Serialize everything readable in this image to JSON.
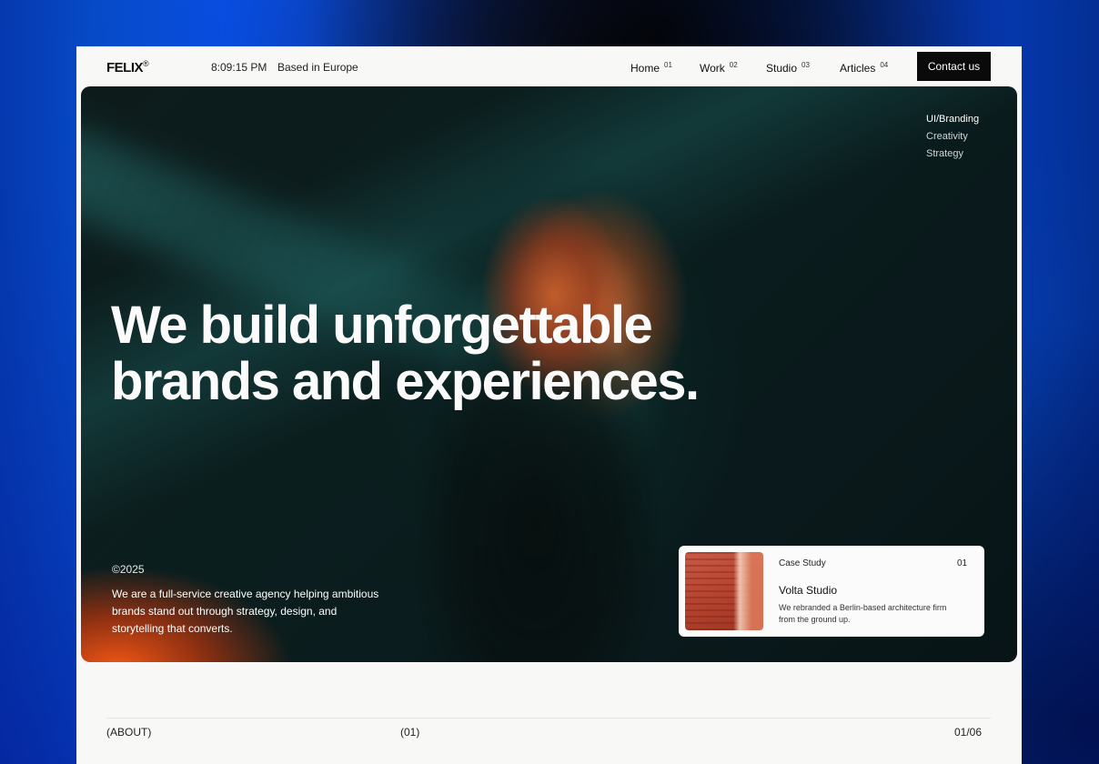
{
  "header": {
    "logo": "FELIX",
    "logo_mark": "®",
    "clock": "8:09:15 PM",
    "location": "Based in Europe",
    "nav": [
      {
        "label": "Home",
        "num": "01"
      },
      {
        "label": "Work",
        "num": "02"
      },
      {
        "label": "Studio",
        "num": "03"
      },
      {
        "label": "Articles",
        "num": "04"
      }
    ],
    "contact_label": "Contact us"
  },
  "hero": {
    "tags": [
      "UI/Branding",
      "Creativity",
      "Strategy"
    ],
    "headline_line1": "We build unforgettable",
    "headline_line2": "brands and experiences.",
    "year": "©2025",
    "description": "We are a full-service creative agency helping ambitious brands stand out through strategy, design, and storytelling that converts."
  },
  "case_study": {
    "label": "Case Study",
    "number": "01",
    "title": "Volta Studio",
    "description": "We rebranded a Berlin-based architecture firm from the ground up."
  },
  "about_section": {
    "label": "(ABOUT)",
    "number": "(01)",
    "count": "01/06"
  }
}
